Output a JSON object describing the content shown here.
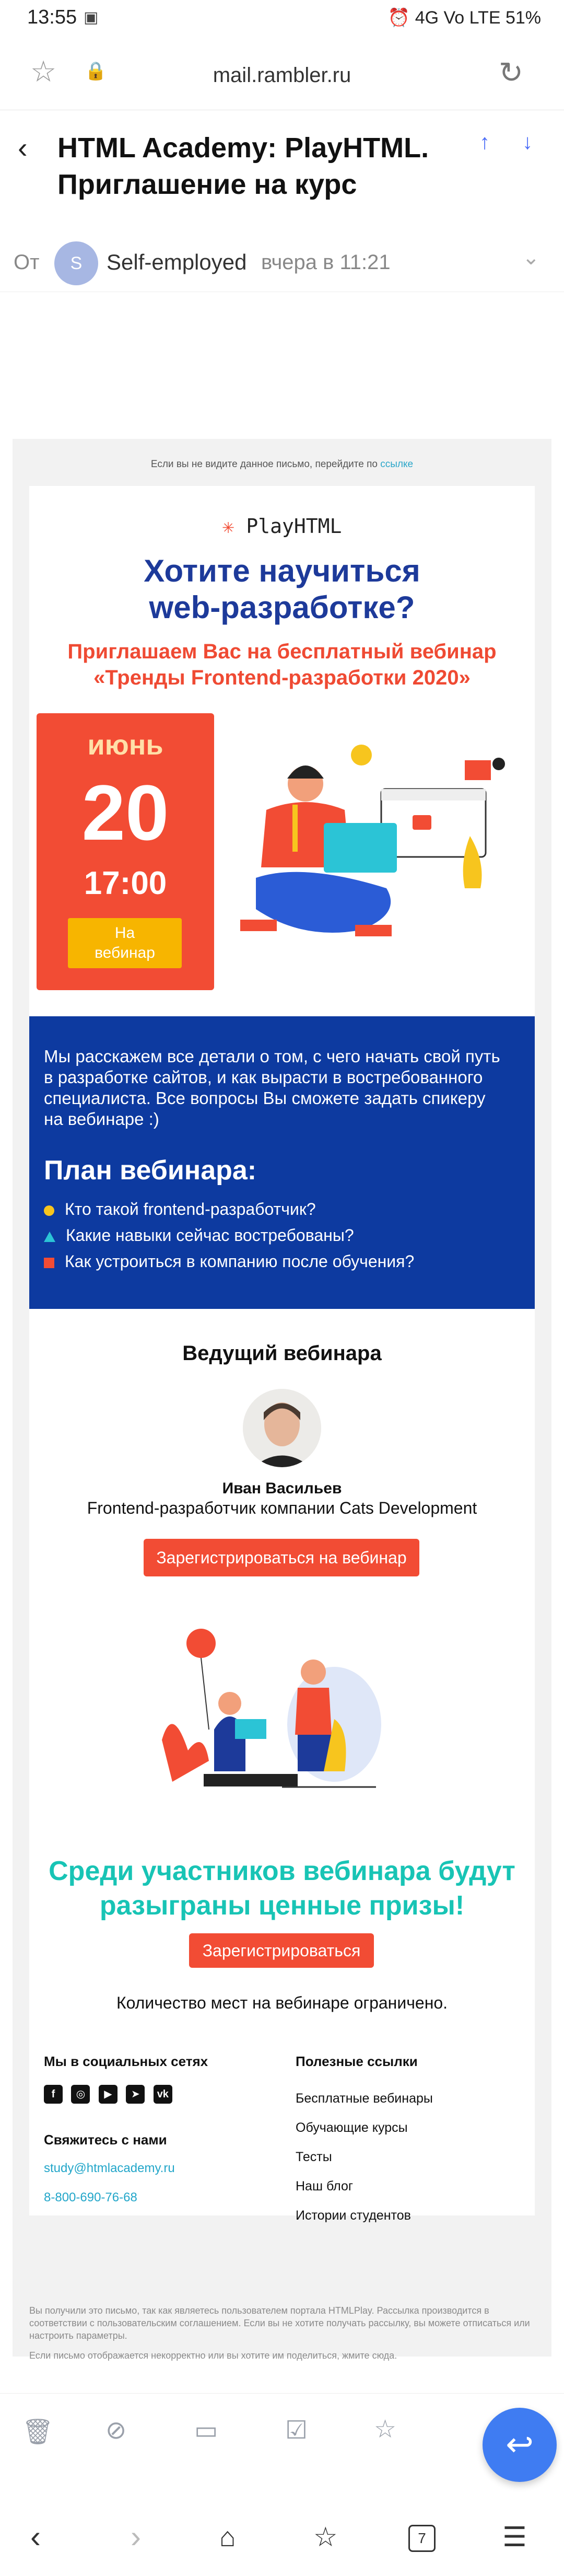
{
  "status_bar": {
    "time": "13:55",
    "right": "⏰ 4G  Vo LTE  51%",
    "battery": "51%"
  },
  "browser": {
    "url": "mail.rambler.ru",
    "tabs_count": "7"
  },
  "mail": {
    "title": "HTML Academy: PlayHTML. Приглашение на курс",
    "from_label": "От",
    "avatar_letter": "S",
    "sender": "Self-employed",
    "date": "вчера в 11:21"
  },
  "email": {
    "preheader_text": "Если вы не видите данное письмо, перейдите по",
    "preheader_link": "ссылке",
    "logo": "PlayHTML",
    "headline_1": "Хотите научиться",
    "headline_2": "web-разработке?",
    "invite_1": "Приглашаем Вас на бесплатный вебинар",
    "invite_2": "«Тренды Frontend-разработки 2020»",
    "month": "июнь",
    "day": "20",
    "hour": "17:00",
    "webinar_button_1": "На",
    "webinar_button_2": "вебинар",
    "intro": "Мы расскажем все детали о том, с чего начать свой путь в разработке сайтов, и как вырасти в востребованного специалиста. Все вопросы Вы сможете задать спикеру на вебинаре :)",
    "plan_title": "План вебинара:",
    "plan_items": [
      {
        "text": "Кто такой frontend-разработчик?",
        "color": "#f7c51e"
      },
      {
        "text": "Какие навыки сейчас востребованы?",
        "color": "#2bc4d6"
      },
      {
        "text": "Как устроиться в компанию после обучения?",
        "color": "#f24c34"
      }
    ],
    "host_title": "Ведущий вебинара",
    "host_name": "Иван Васильев",
    "host_role": "Frontend-разработчик компании Cats Development",
    "register_button": "Зарегистрироваться на вебинар",
    "prize_1": "Среди участников вебинара будут",
    "prize_2": "разыграны ценные призы!",
    "register_button_2": "Зарегистрироваться",
    "limited": "Количество мест на вебинаре ограничено.",
    "social_title": "Мы в социальных сетях",
    "contact_title": "Свяжитесь с нами",
    "email": "study@htmlacademy.ru",
    "phone": "8-800-690-76-68",
    "links_title": "Полезные ссылки",
    "links": [
      "Бесплатные вебинары",
      "Обучающие курсы",
      "Тесты",
      "Наш блог",
      "Истории студентов"
    ],
    "legal_1": "Вы получили это письмо, так как являетесь пользователем портала HTMLPlay. Рассылка производится в соответствии с пользовательским соглашением. Если вы не хотите получать рассылку, вы можете отписаться или настроить параметры.",
    "legal_2": "Если письмо отображается некорректно или вы хотите им поделиться, жмите сюда."
  },
  "colors": {
    "accent_red": "#f24c34",
    "brand_blue": "#0d3aa0",
    "teal": "#18c4b5",
    "fab_blue": "#3f7cf2"
  }
}
